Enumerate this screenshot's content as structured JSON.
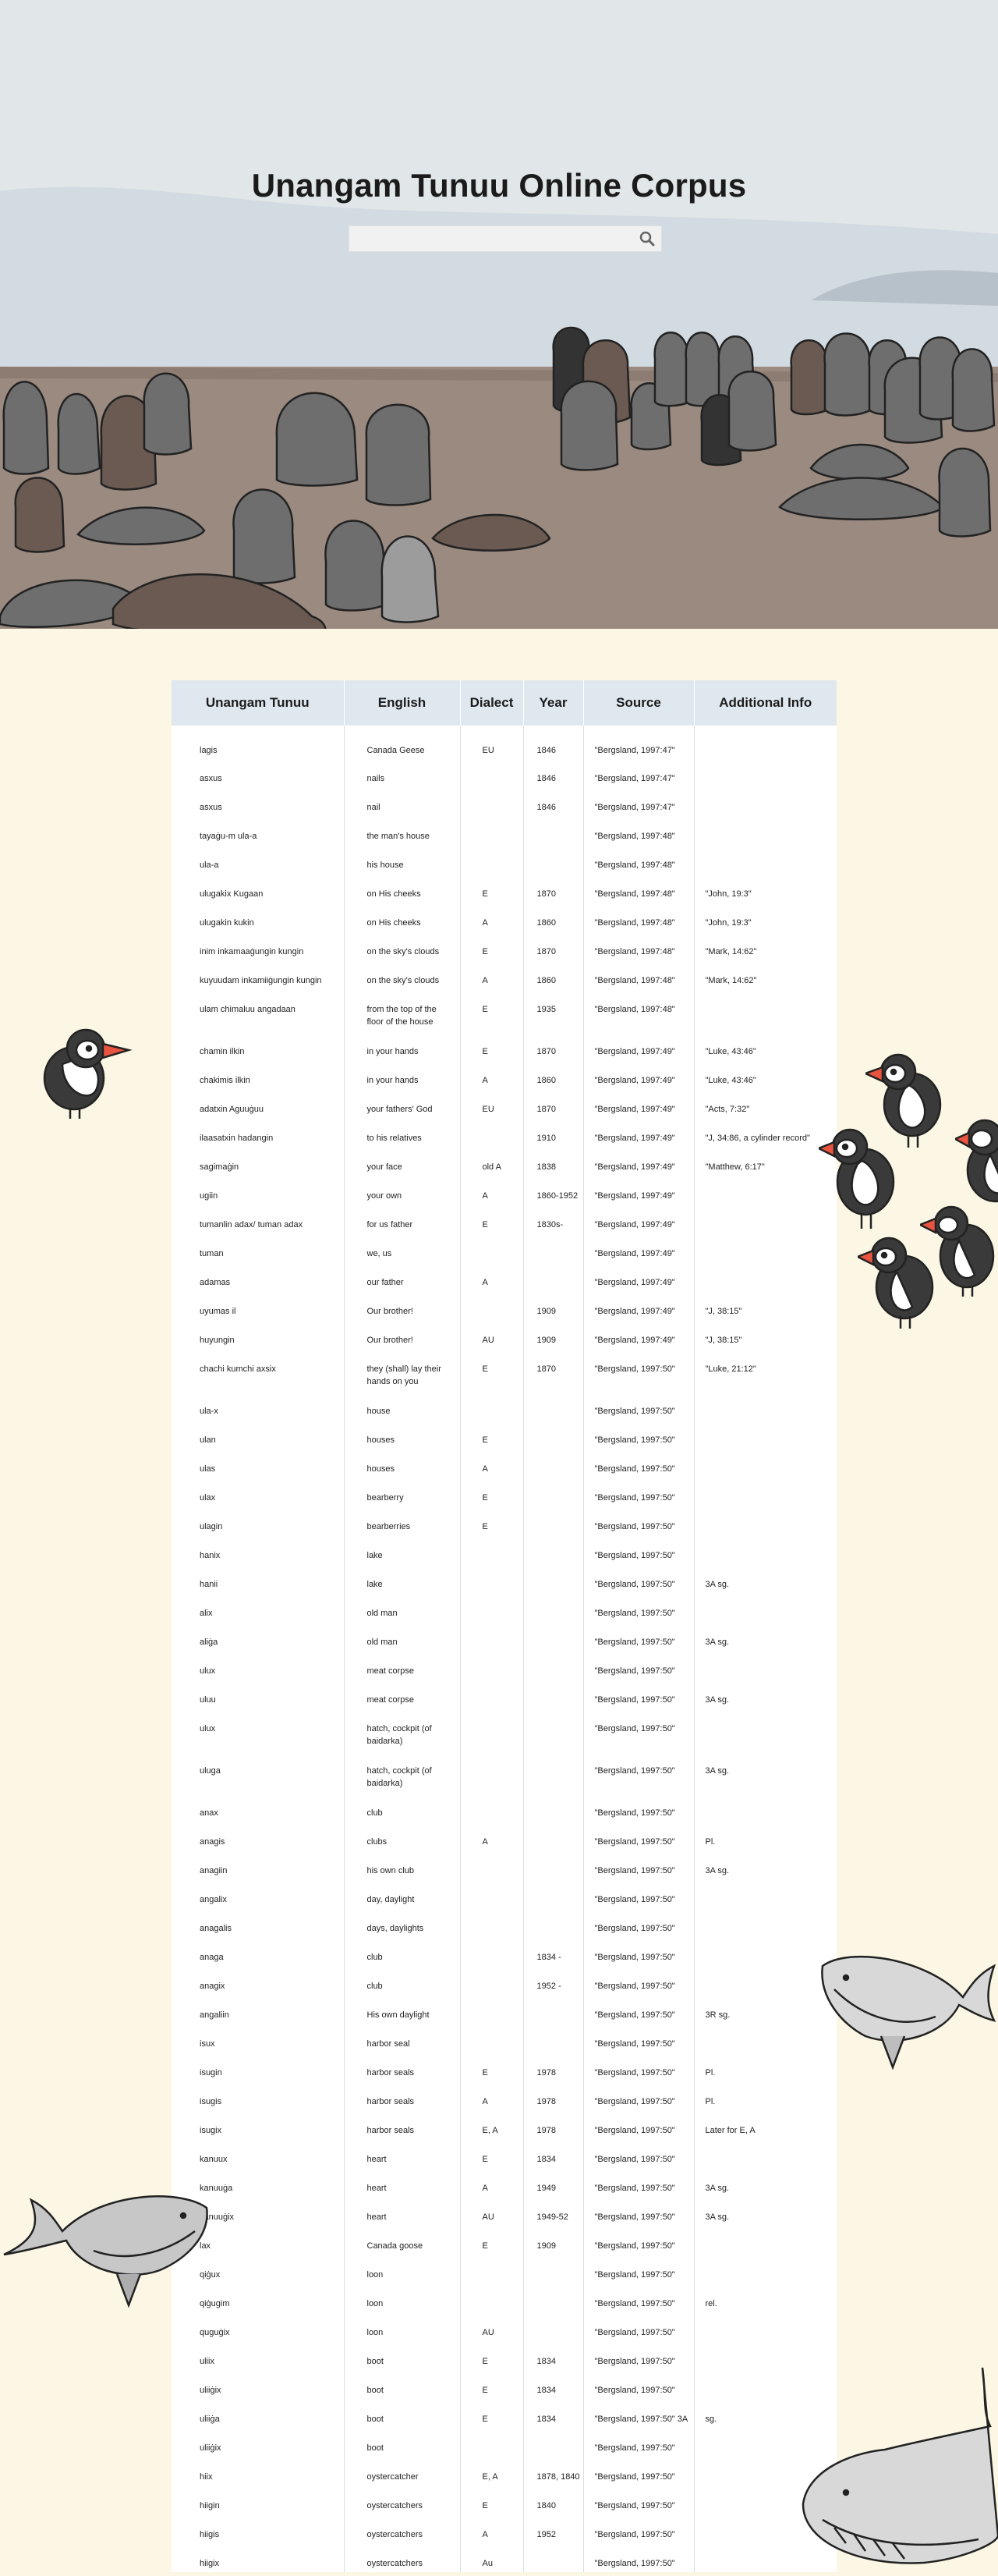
{
  "site": {
    "title": "Unangam Tunuu Online Corpus",
    "search_placeholder": "",
    "search_icon": "magnifier-icon"
  },
  "colors": {
    "page_background": "#fbf7e4",
    "sky": "#e1e6e8",
    "beach": "#9a8a80",
    "table_header": "#dfe8ef",
    "seal_gray": "#6e6e6e",
    "seal_brown": "#6a5a52"
  },
  "table": {
    "headers": [
      "Unangam Tunuu",
      "English",
      "Dialect",
      "Year",
      "Source",
      "Additional Info"
    ],
    "rows": [
      [
        "lagis",
        "Canada Geese",
        "EU",
        "1846",
        "\"Bergsland, 1997:47\"",
        ""
      ],
      [
        "asxus",
        "nails",
        "",
        "1846",
        "\"Bergsland, 1997:47\"",
        ""
      ],
      [
        "asxus",
        "nail",
        "",
        "1846",
        "\"Bergsland, 1997:47\"",
        ""
      ],
      [
        "tayaġu-m ula-a",
        "the man's house",
        "",
        "",
        "\"Bergsland, 1997:48\"",
        ""
      ],
      [
        "ula-a",
        "his house",
        "",
        "",
        "\"Bergsland, 1997:48\"",
        ""
      ],
      [
        "ulugakix Kugaan",
        "on His cheeks",
        "E",
        "1870",
        "\"Bergsland, 1997:48\"",
        "\"John, 19:3\""
      ],
      [
        "ulugakin kukin",
        "on His cheeks",
        "A",
        "1860",
        "\"Bergsland, 1997:48\"",
        "\"John, 19:3\""
      ],
      [
        "inim inkamaaġungin kungin",
        "on the sky's clouds",
        "E",
        "1870",
        "\"Bergsland, 1997:48\"",
        "\"Mark, 14:62\""
      ],
      [
        "kuyuudam inkamiiġungin kungin",
        "on the sky's clouds",
        "A",
        "1860",
        "\"Bergsland, 1997:48\"",
        "\"Mark, 14:62\""
      ],
      [
        "ulam chimaluu angadaan",
        "from the top of the floor of the house",
        "E",
        "1935",
        "\"Bergsland, 1997:48\"",
        ""
      ],
      [
        "chamin ilkin",
        "in your hands",
        "E",
        "1870",
        "\"Bergsland, 1997:49\"",
        "\"Luke, 43:46\""
      ],
      [
        "chakimis ilkin",
        "in your hands",
        "A",
        "1860",
        "\"Bergsland, 1997:49\"",
        "\"Luke, 43:46\""
      ],
      [
        "adatxin Aguuġuu",
        "your fathers' God",
        "EU",
        "1870",
        "\"Bergsland, 1997:49\"",
        "\"Acts, 7:32\""
      ],
      [
        "ilaasatxin hadangin",
        "to his relatives",
        "",
        "1910",
        "\"Bergsland, 1997:49\"",
        "\"J, 34:86, a cylinder record\""
      ],
      [
        "sagimaġin",
        "your face",
        "old A",
        "1838",
        "\"Bergsland, 1997:49\"",
        "\"Matthew, 6:17\""
      ],
      [
        "ugiin",
        "your own",
        "A",
        "1860-1952",
        "\"Bergsland, 1997:49\"",
        ""
      ],
      [
        "tumanlin adax/ tuman adax",
        "for us father",
        "E",
        "1830s-",
        "\"Bergsland, 1997:49\"",
        ""
      ],
      [
        "tuman",
        "we, us",
        "",
        "",
        "\"Bergsland, 1997:49\"",
        ""
      ],
      [
        "adamas",
        "our father",
        "A",
        "",
        "\"Bergsland, 1997:49\"",
        ""
      ],
      [
        "uyumas il",
        "Our brother!",
        "",
        "1909",
        "\"Bergsland, 1997:49\"",
        "\"J, 38:15\""
      ],
      [
        "huyungin",
        "Our brother!",
        "AU",
        "1909",
        "\"Bergsland, 1997:49\"",
        "\"J, 38:15\""
      ],
      [
        "chachi kumchi axsix",
        "they (shall) lay their hands on you",
        "E",
        "1870",
        "\"Bergsland, 1997:50\"",
        "\"Luke, 21:12\""
      ],
      [
        "ula-x",
        "house",
        "",
        "",
        "\"Bergsland, 1997:50\"",
        ""
      ],
      [
        "ulan",
        "houses",
        "E",
        "",
        "\"Bergsland, 1997:50\"",
        ""
      ],
      [
        "ulas",
        "houses",
        "A",
        "",
        "\"Bergsland, 1997:50\"",
        ""
      ],
      [
        "ulax",
        "bearberry",
        "E",
        "",
        "\"Bergsland, 1997:50\"",
        ""
      ],
      [
        "ulagin",
        "bearberries",
        "E",
        "",
        "\"Bergsland, 1997:50\"",
        ""
      ],
      [
        "hanix",
        "lake",
        "",
        "",
        "\"Bergsland, 1997:50\"",
        ""
      ],
      [
        "hanii",
        "lake",
        "",
        "",
        "\"Bergsland, 1997:50\"",
        "3A sg."
      ],
      [
        "alix",
        "old man",
        "",
        "",
        "\"Bergsland, 1997:50\"",
        ""
      ],
      [
        "aliġa",
        "old man",
        "",
        "",
        "\"Bergsland, 1997:50\"",
        "3A sg."
      ],
      [
        "ulux",
        "meat corpse",
        "",
        "",
        "\"Bergsland, 1997:50\"",
        ""
      ],
      [
        "uluu",
        "meat corpse",
        "",
        "",
        "\"Bergsland, 1997:50\"",
        "3A sg."
      ],
      [
        "ulux",
        "hatch, cockpit (of baidarka)",
        "",
        "",
        "\"Bergsland, 1997:50\"",
        ""
      ],
      [
        "uluga",
        "hatch, cockpit (of baidarka)",
        "",
        "",
        "\"Bergsland, 1997:50\"",
        "3A sg."
      ],
      [
        "anax",
        "club",
        "",
        "",
        "\"Bergsland, 1997:50\"",
        ""
      ],
      [
        "anagis",
        "clubs",
        "A",
        "",
        "\"Bergsland, 1997:50\"",
        "Pl."
      ],
      [
        "anagiin",
        "his own club",
        "",
        "",
        "\"Bergsland, 1997:50\"",
        "3A sg."
      ],
      [
        "angalix",
        "day, daylight",
        "",
        "",
        "\"Bergsland, 1997:50\"",
        ""
      ],
      [
        "anagalis",
        "days, daylights",
        "",
        "",
        "\"Bergsland, 1997:50\"",
        ""
      ],
      [
        "anaga",
        "club",
        "",
        "1834 -",
        "\"Bergsland, 1997:50\"",
        ""
      ],
      [
        "anagix",
        "club",
        "",
        "1952 -",
        "\"Bergsland, 1997:50\"",
        ""
      ],
      [
        "angaliin",
        "His own daylight",
        "",
        "",
        "\"Bergsland, 1997:50\"",
        "3R sg."
      ],
      [
        "isux",
        "harbor seal",
        "",
        "",
        "\"Bergsland, 1997:50\"",
        ""
      ],
      [
        "isugin",
        "harbor seals",
        "E",
        "1978",
        "\"Bergsland, 1997:50\"",
        "Pl."
      ],
      [
        "isugis",
        "harbor seals",
        "A",
        "1978",
        "\"Bergsland, 1997:50\"",
        "Pl."
      ],
      [
        "isugix",
        "harbor seals",
        "E, A",
        "1978",
        "\"Bergsland, 1997:50\"",
        "Later for E, A"
      ],
      [
        "kanuux",
        "heart",
        "E",
        "1834",
        "\"Bergsland, 1997:50\"",
        ""
      ],
      [
        "kanuuġa",
        "heart",
        "A",
        "1949",
        "\"Bergsland, 1997:50\"",
        "3A sg."
      ],
      [
        "kanuuġix",
        "heart",
        "AU",
        "1949-52",
        "\"Bergsland, 1997:50\"",
        "3A sg."
      ],
      [
        "lax",
        "Canada goose",
        "E",
        "1909",
        "\"Bergsland, 1997:50\"",
        ""
      ],
      [
        "qiġux",
        "loon",
        "",
        "",
        "\"Bergsland, 1997:50\"",
        ""
      ],
      [
        "qiġugim",
        "loon",
        "",
        "",
        "\"Bergsland, 1997:50\"",
        "rel."
      ],
      [
        "quguġix",
        "loon",
        "AU",
        "",
        "\"Bergsland, 1997:50\"",
        ""
      ],
      [
        "uliix",
        "boot",
        "E",
        "1834",
        "\"Bergsland, 1997:50\"",
        ""
      ],
      [
        "uliiġix",
        "boot",
        "E",
        "1834",
        "\"Bergsland, 1997:50\"",
        ""
      ],
      [
        "uliiġa",
        "boot",
        "E",
        "1834",
        "\"Bergsland, 1997:50\"  3A",
        "sg."
      ],
      [
        "uliiġix",
        "boot",
        "",
        "",
        "\"Bergsland, 1997:50\"",
        ""
      ],
      [
        "hiix",
        "oystercatcher",
        "E, A",
        "1878, 1840",
        "\"Bergsland, 1997:50\"",
        ""
      ],
      [
        "hiigin",
        "oystercatchers",
        "E",
        "1840",
        "\"Bergsland, 1997:50\"",
        ""
      ],
      [
        "hiigis",
        "oystercatchers",
        "A",
        "1952",
        "\"Bergsland, 1997:50\"",
        ""
      ],
      [
        "hiigix",
        "oystercatchers",
        "Au",
        "",
        "\"Bergsland, 1997:50\"",
        ""
      ]
    ]
  },
  "decorations": {
    "hero_animals": "seal-icon",
    "birds": "puffin-icon",
    "whales": "whale-icon"
  }
}
